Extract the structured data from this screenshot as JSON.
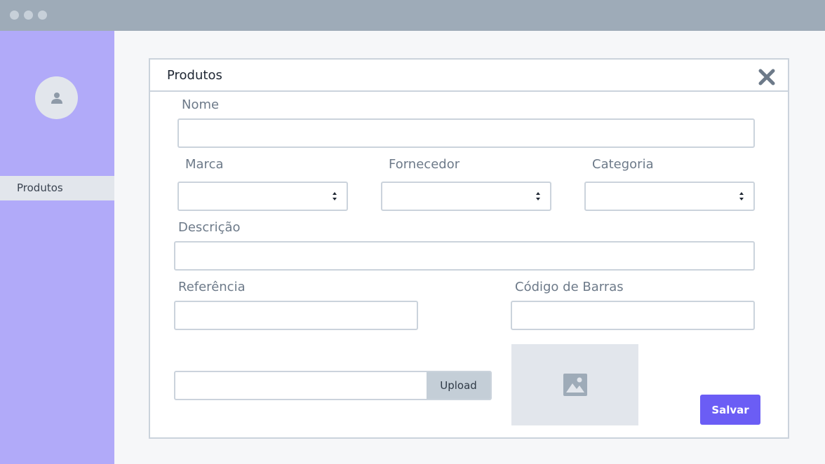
{
  "window": {
    "controls": [
      "window-dot",
      "window-dot",
      "window-dot"
    ]
  },
  "sidebar": {
    "avatar_icon": "user-icon",
    "items": [
      {
        "label": "Produtos",
        "active": true
      }
    ]
  },
  "modal": {
    "title": "Produtos",
    "close_icon": "close-icon",
    "fields": {
      "nome": {
        "label": "Nome",
        "value": ""
      },
      "marca": {
        "label": "Marca",
        "value": ""
      },
      "fornecedor": {
        "label": "Fornecedor",
        "value": ""
      },
      "categoria": {
        "label": "Categoria",
        "value": ""
      },
      "descricao": {
        "label": "Descrição",
        "value": ""
      },
      "referencia": {
        "label": "Referência",
        "value": ""
      },
      "codigo_barras": {
        "label": "Código de Barras",
        "value": ""
      }
    },
    "upload": {
      "button_label": "Upload",
      "value": ""
    },
    "image_icon": "image-icon",
    "save_label": "Salvar"
  },
  "colors": {
    "titlebar": "#9eabb8",
    "sidebar": "#b1aaf9",
    "accent": "#6b5df5",
    "border": "#cbd3dc"
  }
}
